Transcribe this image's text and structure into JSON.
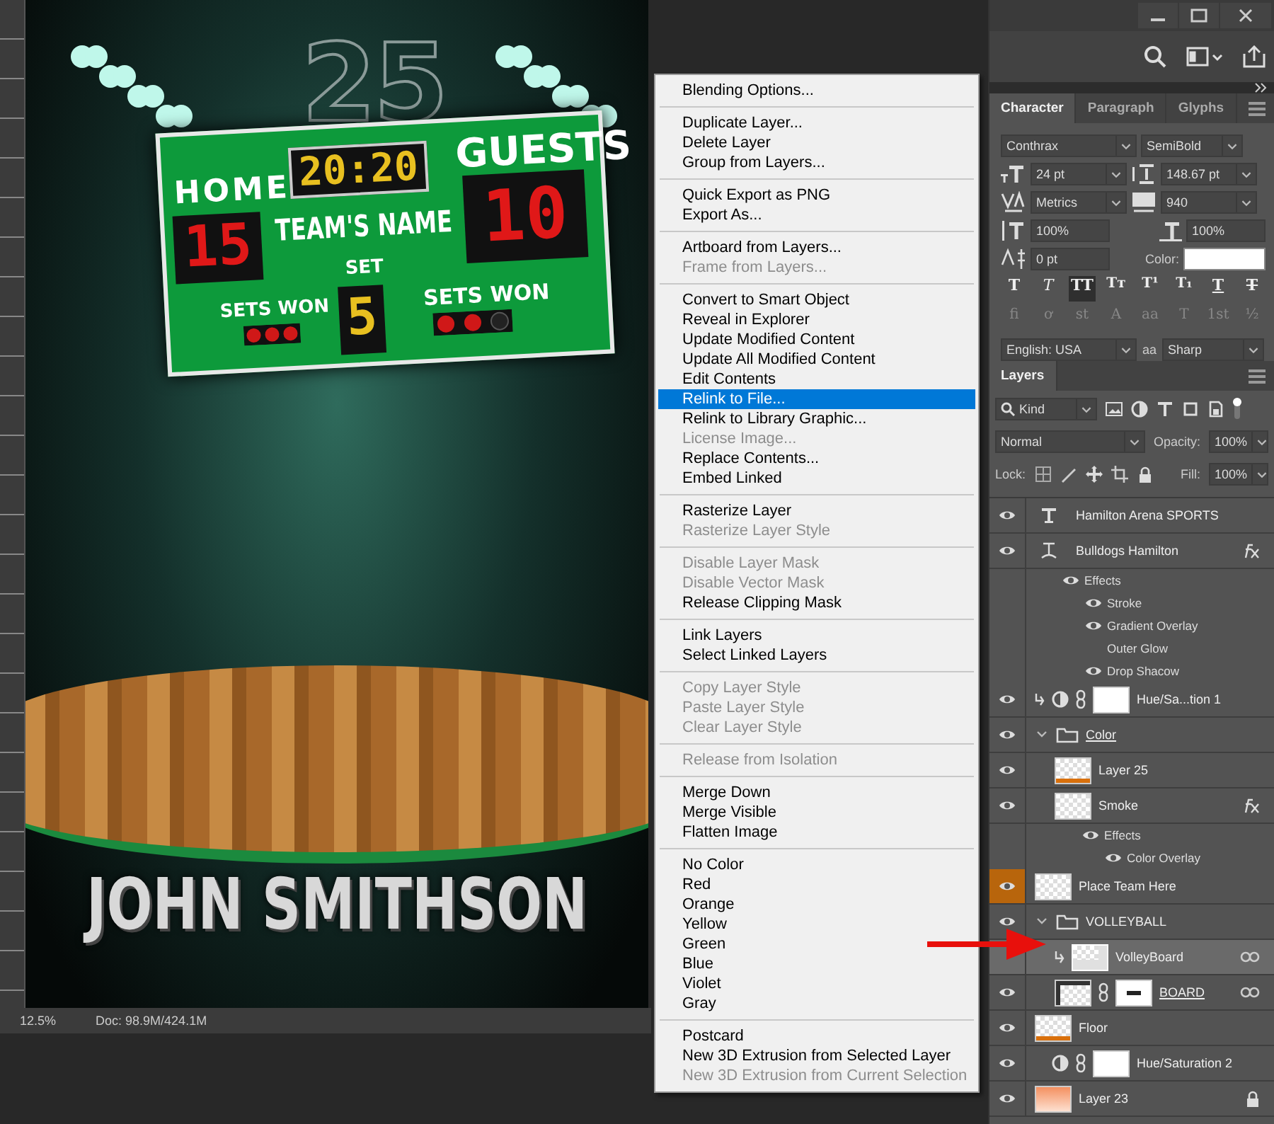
{
  "document": {
    "poster": {
      "number": "25",
      "home_label": "HOME",
      "clock": "20:20",
      "guests_label": "GUESTS",
      "home_score": "15",
      "team_name": "TEAM'S NAME",
      "guests_score": "10",
      "set_label": "SET",
      "set_value": "5",
      "home_sets_label": "SETS WON",
      "guests_sets_label": "SETS WON",
      "player_name": "JOHN SMITHSON"
    },
    "status_bar": {
      "zoom": "12.5%",
      "doc_size": "Doc: 98.9M/424.1M"
    }
  },
  "context_menu": {
    "groups": [
      [
        {
          "label": "Blending Options...",
          "disabled": false,
          "selected": false
        }
      ],
      [
        {
          "label": "Duplicate Layer...",
          "disabled": false,
          "selected": false
        },
        {
          "label": "Delete Layer",
          "disabled": false,
          "selected": false
        },
        {
          "label": "Group from Layers...",
          "disabled": false,
          "selected": false
        }
      ],
      [
        {
          "label": "Quick Export as PNG",
          "disabled": false,
          "selected": false
        },
        {
          "label": "Export As...",
          "disabled": false,
          "selected": false
        }
      ],
      [
        {
          "label": "Artboard from Layers...",
          "disabled": false,
          "selected": false
        },
        {
          "label": "Frame from Layers...",
          "disabled": true,
          "selected": false
        }
      ],
      [
        {
          "label": "Convert to Smart Object",
          "disabled": false,
          "selected": false
        },
        {
          "label": "Reveal in Explorer",
          "disabled": false,
          "selected": false
        },
        {
          "label": "Update Modified Content",
          "disabled": false,
          "selected": false
        },
        {
          "label": "Update All Modified Content",
          "disabled": false,
          "selected": false
        },
        {
          "label": "Edit Contents",
          "disabled": false,
          "selected": false
        },
        {
          "label": "Relink to File...",
          "disabled": false,
          "selected": true
        },
        {
          "label": "Relink to Library Graphic...",
          "disabled": false,
          "selected": false
        },
        {
          "label": "License Image...",
          "disabled": true,
          "selected": false
        },
        {
          "label": "Replace Contents...",
          "disabled": false,
          "selected": false
        },
        {
          "label": "Embed Linked",
          "disabled": false,
          "selected": false
        }
      ],
      [
        {
          "label": "Rasterize Layer",
          "disabled": false,
          "selected": false
        },
        {
          "label": "Rasterize Layer Style",
          "disabled": true,
          "selected": false
        }
      ],
      [
        {
          "label": "Disable Layer Mask",
          "disabled": true,
          "selected": false
        },
        {
          "label": "Disable Vector Mask",
          "disabled": true,
          "selected": false
        },
        {
          "label": "Release Clipping Mask",
          "disabled": false,
          "selected": false
        }
      ],
      [
        {
          "label": "Link Layers",
          "disabled": false,
          "selected": false
        },
        {
          "label": "Select Linked Layers",
          "disabled": false,
          "selected": false
        }
      ],
      [
        {
          "label": "Copy Layer Style",
          "disabled": true,
          "selected": false
        },
        {
          "label": "Paste Layer Style",
          "disabled": true,
          "selected": false
        },
        {
          "label": "Clear Layer Style",
          "disabled": true,
          "selected": false
        }
      ],
      [
        {
          "label": "Release from Isolation",
          "disabled": true,
          "selected": false
        }
      ],
      [
        {
          "label": "Merge Down",
          "disabled": false,
          "selected": false
        },
        {
          "label": "Merge Visible",
          "disabled": false,
          "selected": false
        },
        {
          "label": "Flatten Image",
          "disabled": false,
          "selected": false
        }
      ],
      [
        {
          "label": "No Color",
          "disabled": false,
          "selected": false
        },
        {
          "label": "Red",
          "disabled": false,
          "selected": false
        },
        {
          "label": "Orange",
          "disabled": false,
          "selected": false
        },
        {
          "label": "Yellow",
          "disabled": false,
          "selected": false
        },
        {
          "label": "Green",
          "disabled": false,
          "selected": false
        },
        {
          "label": "Blue",
          "disabled": false,
          "selected": false
        },
        {
          "label": "Violet",
          "disabled": false,
          "selected": false
        },
        {
          "label": "Gray",
          "disabled": false,
          "selected": false
        }
      ],
      [
        {
          "label": "Postcard",
          "disabled": false,
          "selected": false
        },
        {
          "label": "New 3D Extrusion from Selected Layer",
          "disabled": false,
          "selected": false
        },
        {
          "label": "New 3D Extrusion from Current Selection",
          "disabled": true,
          "selected": false
        }
      ]
    ]
  },
  "character_panel": {
    "tabs": [
      {
        "label": "Character",
        "selected": true
      },
      {
        "label": "Paragraph",
        "selected": false
      },
      {
        "label": "Glyphs",
        "selected": false
      }
    ],
    "font_family": "Conthrax",
    "font_style": "SemiBold",
    "size": "24 pt",
    "leading": "148.67 pt",
    "kerning": "Metrics",
    "tracking": "940",
    "vertical_scale": "100%",
    "horizontal_scale": "100%",
    "baseline_shift": "0 pt",
    "color_label": "Color:",
    "color": "#ffffff",
    "style_buttons": [
      {
        "glyph": "T",
        "selected": false
      },
      {
        "glyph": "T",
        "selected": false
      },
      {
        "glyph": "TT",
        "selected": true
      },
      {
        "glyph": "Tт",
        "selected": false
      },
      {
        "glyph": "T¹",
        "selected": false
      },
      {
        "glyph": "T₁",
        "selected": false
      },
      {
        "glyph": "T",
        "selected": false
      },
      {
        "glyph": "T",
        "selected": false
      }
    ],
    "opentype_buttons": [
      {
        "glyph": "fi",
        "selected": false
      },
      {
        "glyph": "ơ",
        "selected": false
      },
      {
        "glyph": "st",
        "selected": false
      },
      {
        "glyph": "A",
        "selected": false
      },
      {
        "glyph": "aa",
        "selected": false
      },
      {
        "glyph": "T",
        "selected": false
      },
      {
        "glyph": "1st",
        "selected": false
      },
      {
        "glyph": "½",
        "selected": false
      }
    ],
    "language": "English: USA",
    "antialias_icon": "aa",
    "antialias": "Sharp"
  },
  "layers_panel": {
    "tab": "Layers",
    "filter": "Kind",
    "blend_mode": "Normal",
    "opacity_label": "Opacity:",
    "opacity": "100%",
    "lock_label": "Lock:",
    "fill_label": "Fill:",
    "fill": "100%",
    "layers": [
      {
        "kind": "text",
        "name": "Hamilton Arena SPORTS",
        "visible": true,
        "selected": false
      },
      {
        "kind": "warped-text",
        "name": "Bulldogs Hamilton",
        "visible": true,
        "selected": false,
        "fx": true,
        "children": [
          {
            "kind": "effects",
            "name": "Effects",
            "visible": true,
            "children": [
              {
                "kind": "effect",
                "name": "Stroke",
                "visible": true
              },
              {
                "kind": "effect",
                "name": "Gradient Overlay",
                "visible": true
              },
              {
                "kind": "effect",
                "name": "Outer Glow",
                "visible": false
              },
              {
                "kind": "effect",
                "name": "Drop Shacow",
                "visible": true
              }
            ]
          }
        ]
      },
      {
        "kind": "adjustment",
        "name": "Hue/Sa...tion 1",
        "visible": true,
        "selected": false,
        "clipped": true
      },
      {
        "kind": "group",
        "name": "Color",
        "visible": true,
        "selected": false,
        "expanded": true,
        "children": [
          {
            "kind": "stripe",
            "name": "Layer 25",
            "visible": true,
            "selected": false
          },
          {
            "kind": "transparent",
            "name": "Smoke",
            "visible": true,
            "selected": false,
            "fx": true,
            "children": [
              {
                "kind": "effects",
                "name": "Effects",
                "visible": true,
                "children": [
                  {
                    "kind": "effect",
                    "name": "Color Overlay",
                    "visible": true
                  }
                ]
              }
            ]
          }
        ]
      },
      {
        "kind": "transparent",
        "name": "Place Team Here",
        "visible": true,
        "selected": false,
        "color": "#b8650c"
      },
      {
        "kind": "group",
        "name": "VOLLEYBALL",
        "visible": true,
        "selected": false,
        "expanded": true,
        "children": [
          {
            "kind": "smart",
            "name": "VolleyBoard",
            "visible": false,
            "selected": true,
            "clipped": true,
            "linked": true
          },
          {
            "kind": "masked",
            "name": "BOARD",
            "visible": true,
            "selected": false,
            "linked": true
          }
        ]
      },
      {
        "kind": "stripe",
        "name": "Floor",
        "visible": true,
        "selected": false
      },
      {
        "kind": "adjustment",
        "name": "Hue/Saturation 2",
        "visible": true,
        "selected": false,
        "clipped": false
      },
      {
        "kind": "gradient",
        "name": "Layer 23",
        "visible": true,
        "selected": false,
        "locked": true
      }
    ]
  }
}
